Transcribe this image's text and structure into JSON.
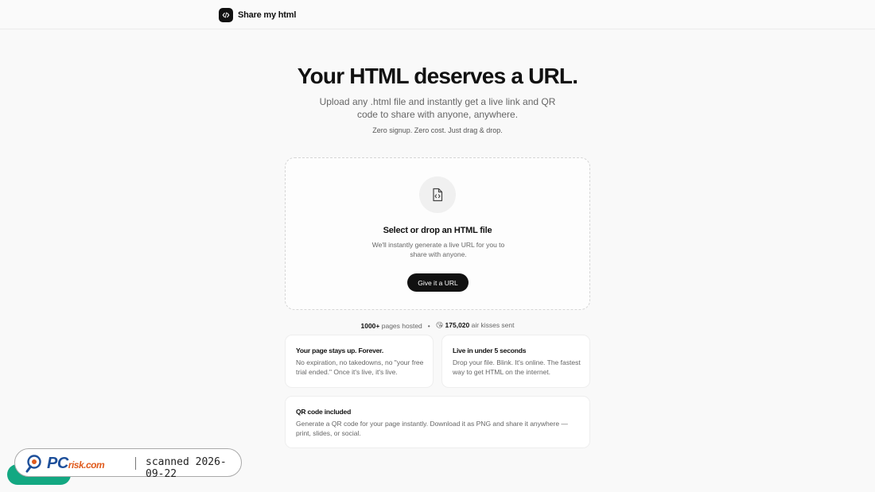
{
  "header": {
    "brand_name": "Share my html",
    "logo_icon": "code-icon"
  },
  "hero": {
    "title": "Your HTML deserves a URL.",
    "subtitle": "Upload any .html file and instantly get a live link and QR code to share with anyone, anywhere.",
    "note": "Zero signup. Zero cost. Just drag & drop."
  },
  "dropzone": {
    "icon": "file-code-icon",
    "title": "Select or drop an HTML file",
    "description": "We'll instantly generate a live URL for you to share with anyone.",
    "button_label": "Give it a URL"
  },
  "stats": {
    "pages_count": "1000+",
    "pages_label": "pages hosted",
    "separator": "•",
    "kisses_icon": "kiss-emoji",
    "kisses_count": "175,020",
    "kisses_label": "air kisses sent"
  },
  "features": [
    {
      "title": "Your page stays up. Forever.",
      "text": "No expiration, no takedowns, no \"your free trial ended.\" Once it's live, it's live."
    },
    {
      "title": "Live in under 5 seconds",
      "text": "Drop your file. Blink. It's online. The fastest way to get HTML on the internet."
    },
    {
      "title": "QR code included",
      "text": "Generate a QR code for your page instantly. Download it as PNG and share it anywhere — print, slides, or social."
    }
  ],
  "watermark": {
    "brand_main": "PC",
    "brand_suffix": "risk.com",
    "stamp": "scanned 2026-09-22"
  },
  "colors": {
    "primary": "#111111",
    "muted_text": "#666666",
    "background": "#f9f9f9",
    "pill_green": "#13a882"
  }
}
